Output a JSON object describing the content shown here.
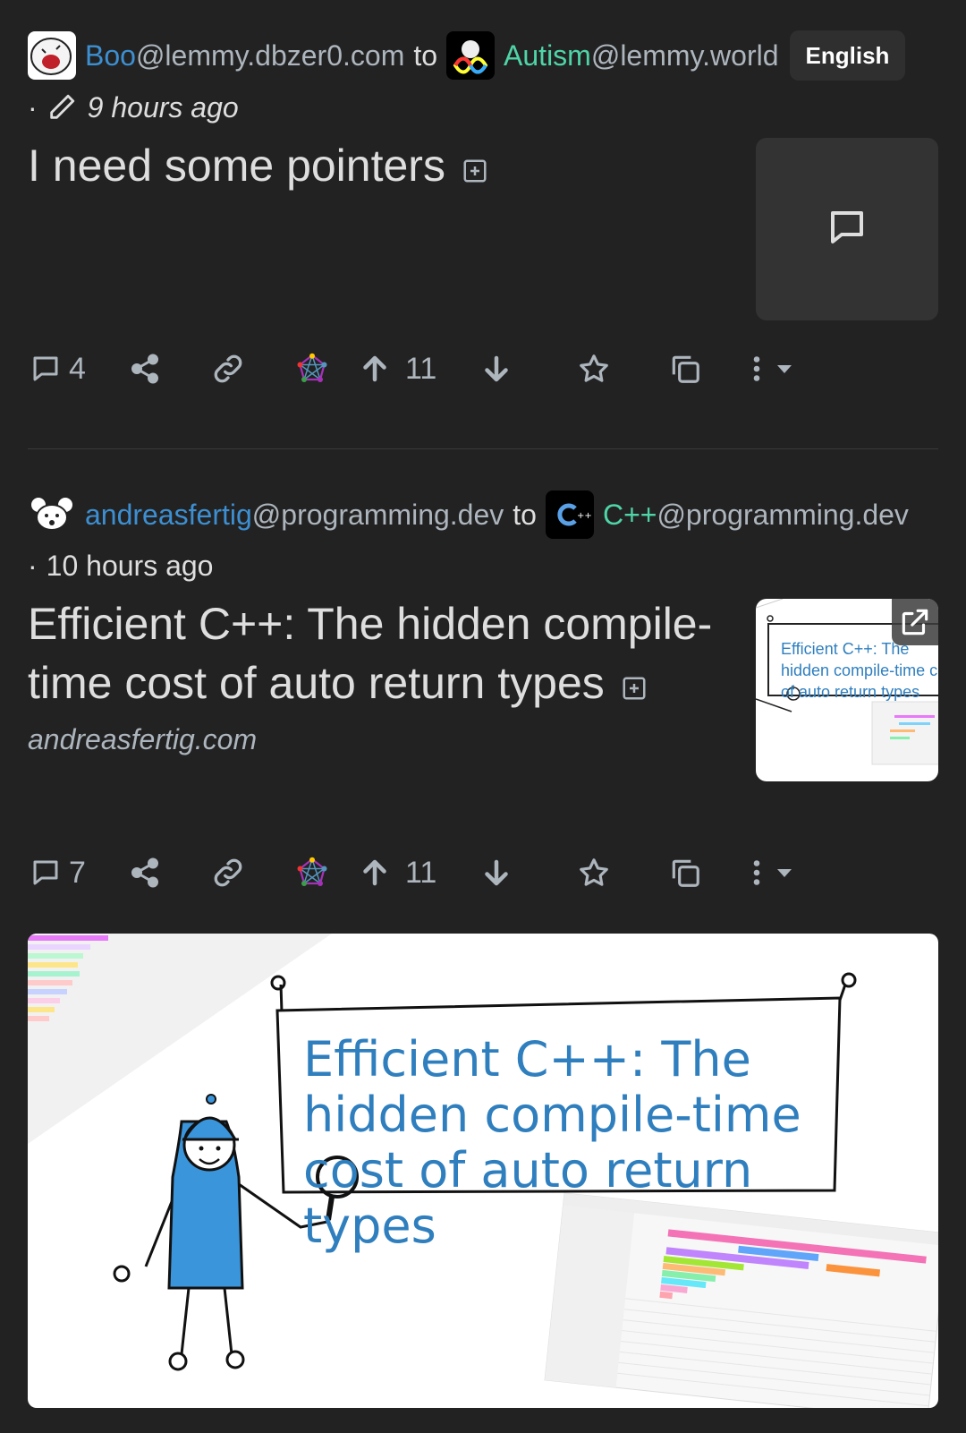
{
  "posts": [
    {
      "author": "Boo",
      "author_instance": "@lemmy.dbzer0.com",
      "to": "to",
      "community": "Autism",
      "community_instance": "@lemmy.world",
      "language": "English",
      "dot": "·",
      "time": "9 hours ago",
      "title": "I need some pointers",
      "comments": "4",
      "score": "11"
    },
    {
      "author": "andreasfertig",
      "author_instance": "@programming.dev",
      "to": "to",
      "community": "C++",
      "community_instance": "@programming.dev",
      "dot": "·",
      "time": "10 hours ago",
      "title": "Efficient C++: The hidden compile-time cost of auto return types",
      "domain": "andreasfertig.com",
      "comments": "7",
      "score": "11",
      "thumbnail_text": "Efficient C++: The hidden compile-time cost of auto return types",
      "image_text": "Efficient C++: The hidden compile-time cost of auto return types"
    }
  ],
  "icons": {
    "comment": "comment-icon",
    "share": "share-icon",
    "link": "link-icon",
    "fediverse": "fediverse-icon",
    "upvote": "arrow-up-icon",
    "downvote": "arrow-down-icon",
    "save": "star-icon",
    "crosspost": "copy-icon",
    "more": "more-vertical-icon",
    "caret": "caret-down-icon"
  },
  "colors": {
    "user": "#3d8fd1",
    "community": "#4fd4a8",
    "background": "#222222",
    "image_title": "#2f7fbf"
  }
}
